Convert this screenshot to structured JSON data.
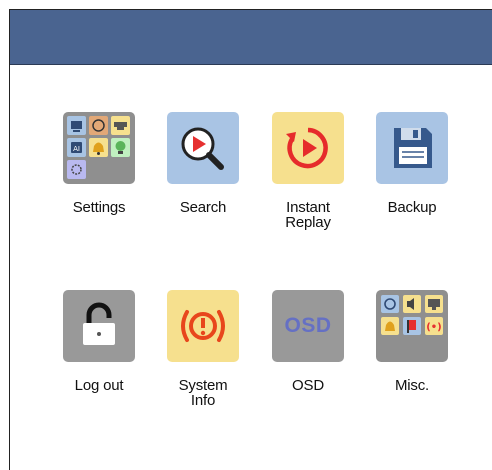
{
  "window": {
    "title_bar_color": "#4a6490"
  },
  "menu": {
    "items": [
      {
        "id": "settings",
        "label": "Settings",
        "icon": "settings-grid-icon",
        "bg": "#8f8f8f"
      },
      {
        "id": "search",
        "label": "Search",
        "icon": "search-play-icon",
        "bg": "#a9c4e4"
      },
      {
        "id": "instant_replay",
        "label": "Instant\nReplay",
        "icon": "instant-replay-icon",
        "bg": "#f6e08e"
      },
      {
        "id": "backup",
        "label": "Backup",
        "icon": "floppy-disk-icon",
        "bg": "#a9c4e4"
      },
      {
        "id": "logout",
        "label": "Log out",
        "icon": "padlock-icon",
        "bg": "#999999"
      },
      {
        "id": "system_info",
        "label": "System\nInfo",
        "icon": "alert-info-icon",
        "bg": "#f6e08e"
      },
      {
        "id": "osd",
        "label": "OSD",
        "icon_text": "OSD",
        "icon": "osd-icon",
        "bg": "#999999"
      },
      {
        "id": "misc",
        "label": "Misc.",
        "icon": "misc-grid-icon",
        "bg": "#8f8f8f"
      }
    ]
  }
}
